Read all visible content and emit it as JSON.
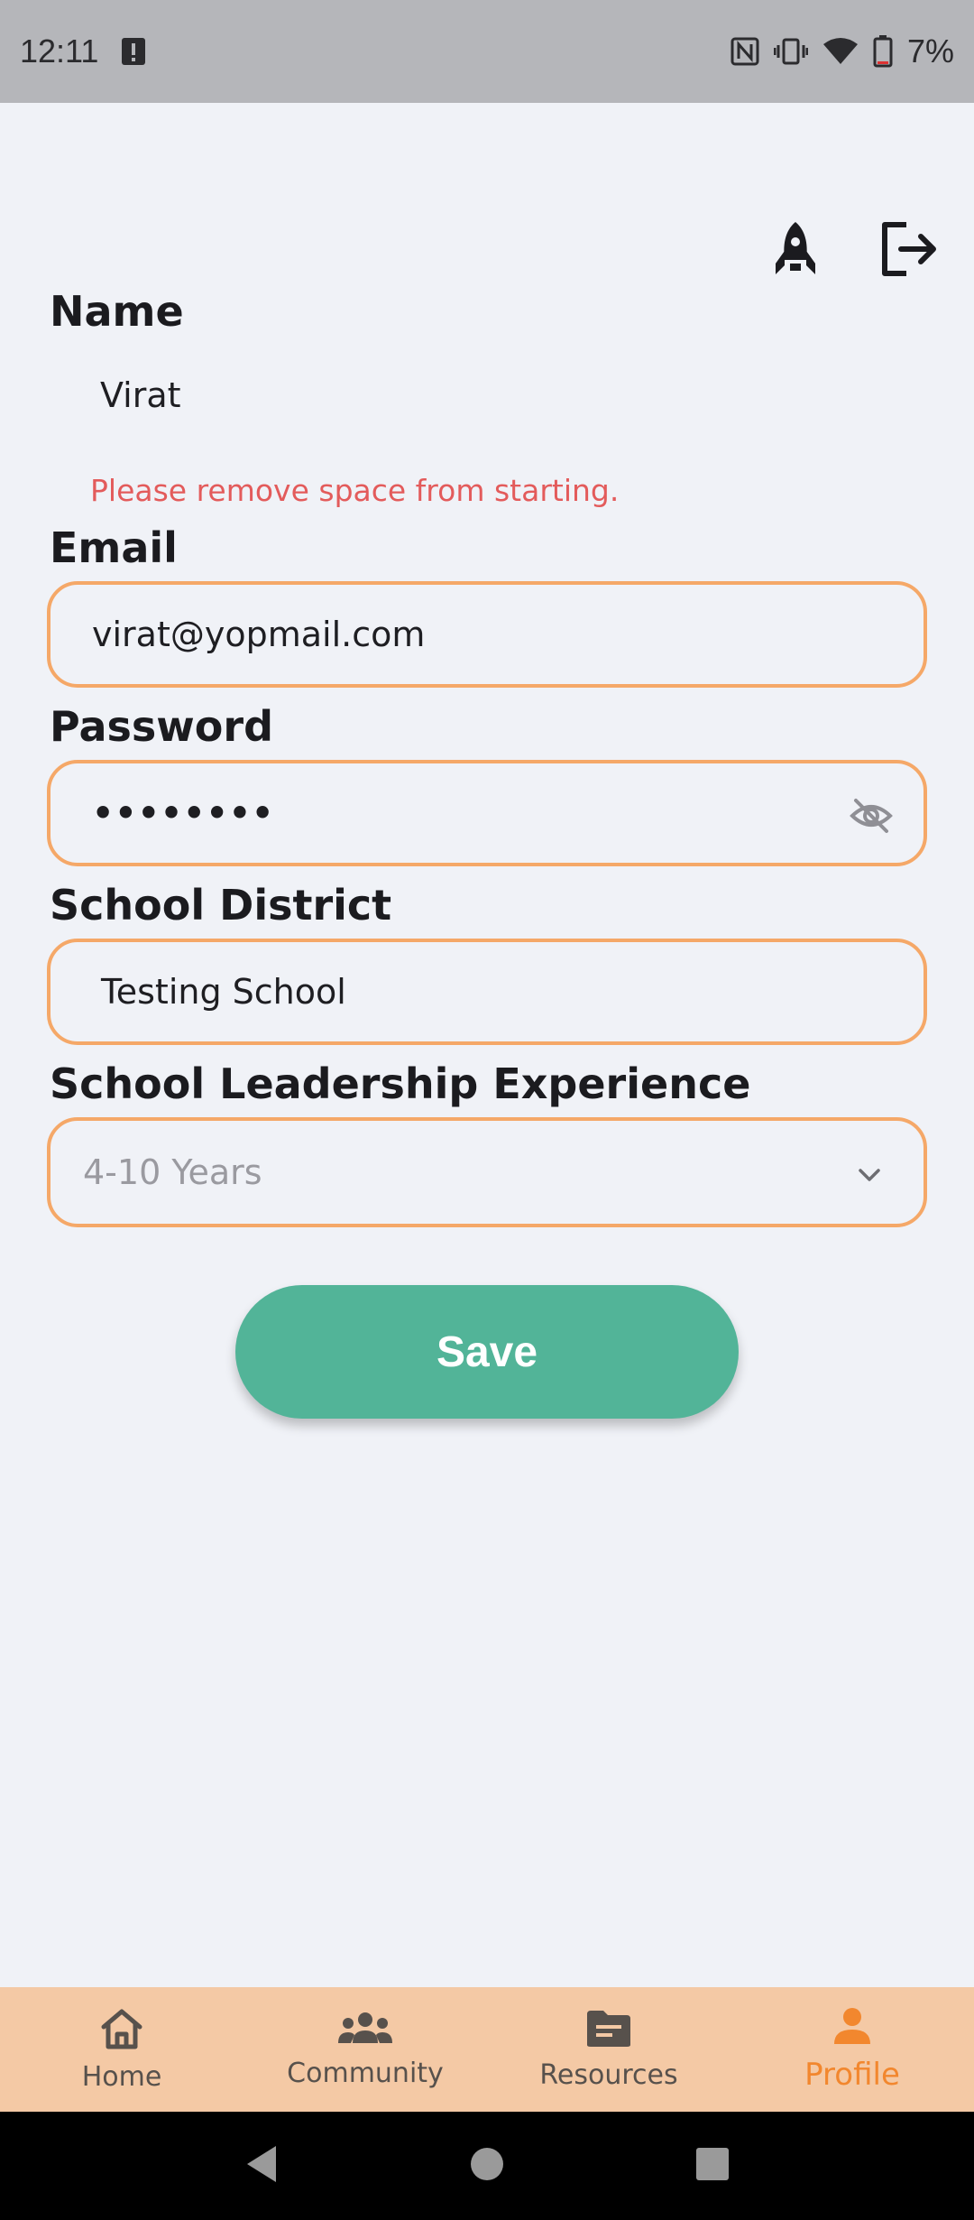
{
  "status_bar": {
    "time": "12:11",
    "battery_percent": "7%"
  },
  "form": {
    "name": {
      "label": "Name",
      "value": "Virat",
      "error": "Please remove space from starting."
    },
    "email": {
      "label": "Email",
      "value": "virat@yopmail.com"
    },
    "password": {
      "label": "Password",
      "value": "••••••••"
    },
    "school_district": {
      "label": "School District",
      "value": "Testing School"
    },
    "experience": {
      "label": "School Leadership Experience",
      "selected": "4-10 Years"
    },
    "save_label": "Save"
  },
  "bottom_nav": {
    "items": [
      {
        "label": "Home",
        "icon": "home-icon"
      },
      {
        "label": "Community",
        "icon": "community-icon"
      },
      {
        "label": "Resources",
        "icon": "resources-icon"
      },
      {
        "label": "Profile",
        "icon": "profile-icon",
        "active": true
      }
    ]
  },
  "colors": {
    "accent_orange": "#f2872e",
    "field_border": "#f5a868",
    "save_green": "#52b498",
    "error_red": "#e35b5b",
    "nav_bg": "#f4c9a5"
  }
}
